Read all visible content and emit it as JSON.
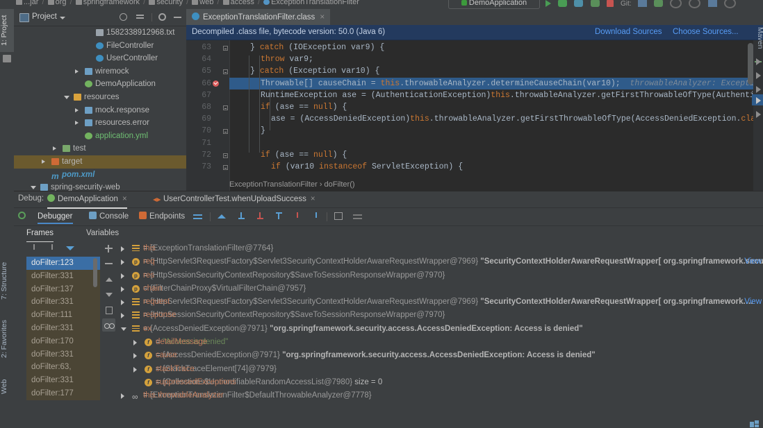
{
  "topbar": {
    "breadcrumbs": [
      "...jar",
      "org",
      "springframework",
      "security",
      "web",
      "access",
      "ExceptionTranslationFilter"
    ],
    "run_config": "DemoApplication",
    "git_label": "Git:"
  },
  "left_strip": {
    "tabs": [
      "1: Project",
      "7: Structure",
      "2: Favorites",
      "Web"
    ]
  },
  "right_strip": {
    "tabs": [
      "Maven"
    ]
  },
  "project_panel": {
    "title": "Project",
    "icons": [
      "locate-icon",
      "collapse-all-icon",
      "gear-icon",
      "minimize-icon"
    ],
    "tree": [
      {
        "label": "1582338912968.txt",
        "indent": 7,
        "icon": "txt-file-icon",
        "arrow": "none",
        "style": "plain"
      },
      {
        "label": "FileController",
        "indent": 7,
        "icon": "class-icon",
        "arrow": "none",
        "style": "cls"
      },
      {
        "label": "UserController",
        "indent": 7,
        "icon": "class-icon",
        "arrow": "none",
        "style": "cls"
      },
      {
        "label": "wiremock",
        "indent": 6,
        "icon": "folder-icon",
        "arrow": "right",
        "style": "plain"
      },
      {
        "label": "DemoApplication",
        "indent": 6,
        "icon": "spring-class-icon",
        "arrow": "none",
        "style": "plain"
      },
      {
        "label": "resources",
        "indent": 5,
        "icon": "resources-folder-icon",
        "arrow": "down",
        "style": "plain"
      },
      {
        "label": "mock.response",
        "indent": 6,
        "icon": "folder-icon",
        "arrow": "right",
        "style": "plain"
      },
      {
        "label": "resources.error",
        "indent": 6,
        "icon": "folder-icon",
        "arrow": "right",
        "style": "plain"
      },
      {
        "label": "application.yml",
        "indent": 6,
        "icon": "yml-file-icon",
        "arrow": "none",
        "style": "green"
      },
      {
        "label": "test",
        "indent": 4,
        "icon": "test-folder-icon",
        "arrow": "right",
        "style": "plain"
      },
      {
        "label": "target",
        "indent": 3,
        "icon": "target-folder-icon",
        "arrow": "right",
        "style": "plain",
        "selected": true
      },
      {
        "label": "pom.xml",
        "indent": 3,
        "icon": "maven-icon",
        "arrow": "none",
        "style": "mvn"
      },
      {
        "label": "spring-security-web",
        "indent": 2,
        "icon": "module-icon",
        "arrow": "down",
        "style": "plain"
      }
    ]
  },
  "editor": {
    "tab": {
      "label": "ExceptionTranslationFilter.class",
      "icon": "class-icon",
      "close": "×"
    },
    "notice": {
      "text": "Decompiled .class file, bytecode version: 50.0 (Java 6)",
      "link1": "Download Sources",
      "link2": "Choose Sources..."
    },
    "breadcrumb": "ExceptionTranslationFilter  ›  doFilter()",
    "lines": [
      {
        "num": "63",
        "fold": true,
        "bp": false,
        "hl": false,
        "indent": 2,
        "text": "} catch (IOException var9) {"
      },
      {
        "num": "64",
        "fold": false,
        "bp": false,
        "hl": false,
        "indent": 3,
        "text": "throw var9;"
      },
      {
        "num": "65",
        "fold": true,
        "bp": false,
        "hl": false,
        "indent": 2,
        "text": "} catch (Exception var10) {"
      },
      {
        "num": "66",
        "fold": false,
        "bp": true,
        "hl": true,
        "indent": 3,
        "text": "Throwable[] causeChain = this.throwableAnalyzer.determineCauseChain(var10);",
        "hint": "throwableAnalyzer: ExceptionTransl…"
      },
      {
        "num": "67",
        "fold": false,
        "bp": false,
        "hl": false,
        "indent": 3,
        "text": "RuntimeException ase = (AuthenticationException)this.throwableAnalyzer.getFirstThrowableOfType(AuthenticationExce"
      },
      {
        "num": "68",
        "fold": true,
        "bp": false,
        "hl": false,
        "indent": 3,
        "text": "if (ase == null) {"
      },
      {
        "num": "69",
        "fold": false,
        "bp": false,
        "hl": false,
        "indent": 4,
        "text": "ase = (AccessDeniedException)this.throwableAnalyzer.getFirstThrowableOfType(AccessDeniedException.class, caus"
      },
      {
        "num": "70",
        "fold": true,
        "bp": false,
        "hl": false,
        "indent": 3,
        "text": "}"
      },
      {
        "num": "71",
        "fold": false,
        "bp": false,
        "hl": false,
        "indent": 0,
        "text": ""
      },
      {
        "num": "72",
        "fold": true,
        "bp": false,
        "hl": false,
        "indent": 3,
        "text": "if (ase == null) {"
      },
      {
        "num": "73",
        "fold": true,
        "bp": false,
        "hl": false,
        "indent": 4,
        "text": "if (var10 instanceof ServletException) {"
      }
    ]
  },
  "debug": {
    "label": "Debug:",
    "session_tabs": [
      {
        "label": "DemoApplication",
        "icon": "spring-icon",
        "close": "×",
        "active": true
      },
      {
        "label": "UserControllerTest.whenUploadSuccess",
        "icon": "test-icon",
        "close": "×",
        "active": false
      }
    ],
    "tool_tabs": [
      {
        "label": "Debugger",
        "icon": "debugger-icon",
        "active": true
      },
      {
        "label": "Console",
        "icon": "console-icon",
        "active": false
      },
      {
        "label": "Endpoints",
        "icon": "endpoints-icon",
        "active": false
      }
    ],
    "toolbar_buttons": [
      "show-execution-point-icon",
      "step-over-icon",
      "step-into-icon",
      "force-step-into-icon",
      "step-out-icon",
      "drop-frame-icon",
      "run-to-cursor-icon",
      "evaluate-expression-icon",
      "settings-icon"
    ],
    "panes": [
      {
        "label": "Frames",
        "active": true
      },
      {
        "label": "Variables",
        "active": false
      }
    ],
    "frame_tools": [
      "thread-up-icon",
      "thread-down-icon",
      "filter-icon"
    ],
    "frames": [
      {
        "label": "doFilter:123",
        "selected": true
      },
      {
        "label": "doFilter:331",
        "selected": false
      },
      {
        "label": "doFilter:137",
        "selected": false
      },
      {
        "label": "doFilter:331",
        "selected": false
      },
      {
        "label": "doFilter:111",
        "selected": false
      },
      {
        "label": "doFilter:331",
        "selected": false
      },
      {
        "label": "doFilter:170",
        "selected": false
      },
      {
        "label": "doFilter:331",
        "selected": false
      },
      {
        "label": "doFilter:63,",
        "selected": false
      },
      {
        "label": "doFilter:331",
        "selected": false
      },
      {
        "label": "doFilter:177",
        "selected": false
      }
    ],
    "side_buttons": [
      "add-watch-icon",
      "remove-watch-icon",
      "move-up-icon",
      "move-down-icon",
      "copy-icon",
      "inspect-icon"
    ],
    "variables": [
      {
        "indent": 0,
        "arrow": "right",
        "icon": "list-icon",
        "name": "this",
        "value": "{ExceptionTranslationFilter@7764}",
        "string": "",
        "link": ""
      },
      {
        "indent": 0,
        "arrow": "right",
        "icon": "param-icon",
        "name": "req",
        "value": "{HttpServlet3RequestFactory$Servlet3SecurityContextHolderAwareRequestWrapper@7969}",
        "string": "\"SecurityContextHolderAwareRequestWrapper[ org.springframework.secu…",
        "link": "View"
      },
      {
        "indent": 0,
        "arrow": "right",
        "icon": "param-icon",
        "name": "res",
        "value": "{HttpSessionSecurityContextRepository$SaveToSessionResponseWrapper@7970}",
        "string": "",
        "link": ""
      },
      {
        "indent": 0,
        "arrow": "right",
        "icon": "param-icon",
        "name": "chain",
        "value": "{FilterChainProxy$VirtualFilterChain@7957}",
        "string": "",
        "link": ""
      },
      {
        "indent": 0,
        "arrow": "right",
        "icon": "list-icon",
        "name": "request",
        "value": "{HttpServlet3RequestFactory$Servlet3SecurityContextHolderAwareRequestWrapper@7969}",
        "string": "\"SecurityContextHolderAwareRequestWrapper[ org.springframework.…",
        "link": "View"
      },
      {
        "indent": 0,
        "arrow": "right",
        "icon": "list-icon",
        "name": "response",
        "value": "{HttpSessionSecurityContextRepository$SaveToSessionResponseWrapper@7970}",
        "string": "",
        "link": ""
      },
      {
        "indent": 0,
        "arrow": "down",
        "icon": "list-icon",
        "name": "ex",
        "value": "{AccessDeniedException@7971}",
        "string": "\"org.springframework.security.access.AccessDeniedException: Access is denied\"",
        "link": ""
      },
      {
        "indent": 1,
        "arrow": "right",
        "icon": "field-icon",
        "name": "detailMessage",
        "value": "",
        "string": "\"Access is denied\"",
        "green": true,
        "link": ""
      },
      {
        "indent": 1,
        "arrow": "right",
        "icon": "field-icon",
        "name": "cause",
        "value": "{AccessDeniedException@7971}",
        "string": "\"org.springframework.security.access.AccessDeniedException: Access is denied\"",
        "link": ""
      },
      {
        "indent": 1,
        "arrow": "right",
        "icon": "field-icon",
        "name": "stackTrace",
        "value": "{StackTraceElement[74]@7979}",
        "string": "",
        "link": ""
      },
      {
        "indent": 1,
        "arrow": "none",
        "icon": "field-icon",
        "name": "suppressedExceptions",
        "value": "{Collections$UnmodifiableRandomAccessList@7980}",
        "string": "",
        "suffix": "size = 0",
        "link": ""
      },
      {
        "indent": 0,
        "arrow": "right",
        "icon": "watch-icon",
        "name": "this.throwableAnalyzer",
        "value": "{ExceptionTranslationFilter$DefaultThrowableAnalyzer@7778}",
        "string": "",
        "link": ""
      }
    ]
  }
}
